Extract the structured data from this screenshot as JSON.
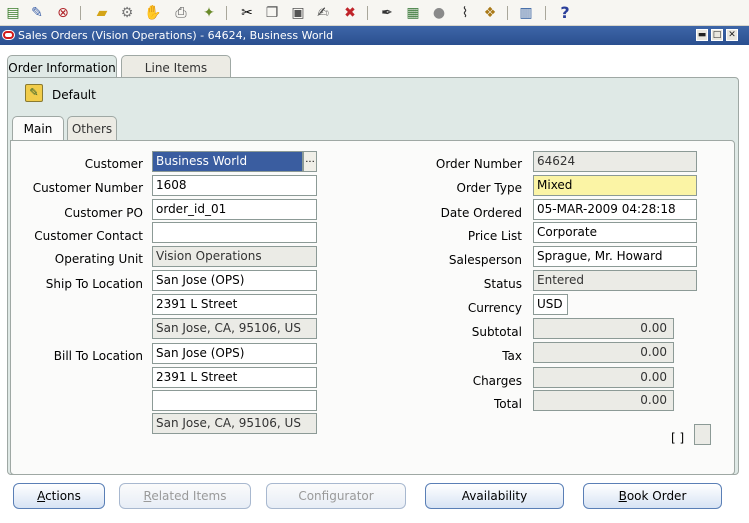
{
  "toolbar": {
    "icons": [
      "new-record-icon",
      "edit-icon",
      "clear-icon",
      "open-folder-icon",
      "navigator-icon",
      "zoom-icon",
      "print-icon",
      "stamp-icon",
      "cut-icon",
      "copy-icon",
      "paste-icon",
      "edit-field-icon",
      "delete-record-icon",
      "pen-icon",
      "form-icon",
      "attachment-ball-icon",
      "paperclip-icon",
      "translate-icon",
      "folder-tools-icon",
      "help-icon"
    ],
    "help_glyph": "?"
  },
  "window": {
    "title": "Sales Orders (Vision Operations) - 64624, Business World",
    "minimize_glyph": "▬",
    "maximize_glyph": "□",
    "close_glyph": "✕"
  },
  "tabs": {
    "order_information": "Order Information",
    "line_items": "Line Items"
  },
  "defaults": {
    "label": "Default"
  },
  "subtabs": {
    "main": "Main",
    "others": "Others"
  },
  "fields": {
    "customer": {
      "label": "Customer",
      "value": "Business World",
      "lov": "..."
    },
    "customer_number": {
      "label": "Customer Number",
      "value": "1608"
    },
    "customer_po": {
      "label": "Customer PO",
      "value": "order_id_01"
    },
    "customer_contact": {
      "label": "Customer Contact",
      "value": ""
    },
    "operating_unit": {
      "label": "Operating Unit",
      "value": "Vision Operations"
    },
    "ship_to": {
      "label": "Ship To Location",
      "line1": "San Jose (OPS)",
      "line2": "2391 L Street",
      "line3": "San Jose, CA, 95106, US"
    },
    "bill_to": {
      "label": "Bill To Location",
      "line1": "San Jose (OPS)",
      "line2": "2391 L Street",
      "line3": "",
      "line4": "San Jose, CA, 95106, US"
    },
    "order_number": {
      "label": "Order Number",
      "value": "64624"
    },
    "order_type": {
      "label": "Order Type",
      "value": "Mixed"
    },
    "date_ordered": {
      "label": "Date Ordered",
      "value": "05-MAR-2009 04:28:18"
    },
    "price_list": {
      "label": "Price List",
      "value": "Corporate"
    },
    "salesperson": {
      "label": "Salesperson",
      "value": "Sprague, Mr. Howard"
    },
    "status": {
      "label": "Status",
      "value": "Entered"
    },
    "currency": {
      "label": "Currency",
      "value": "USD"
    },
    "subtotal": {
      "label": "Subtotal",
      "value": "0.00"
    },
    "tax": {
      "label": "Tax",
      "value": "0.00"
    },
    "charges": {
      "label": "Charges",
      "value": "0.00"
    },
    "total": {
      "label": "Total",
      "value": "0.00"
    }
  },
  "flex_field": {
    "label": "[ ]"
  },
  "buttons": {
    "actions": {
      "prefix": "A",
      "rest": "ctions"
    },
    "related_items": {
      "prefix": "R",
      "rest": "elated Items"
    },
    "configurator": {
      "prefix": "",
      "rest": "Configurator"
    },
    "availability": {
      "prefix": "",
      "rest": "Availability"
    },
    "book_order": {
      "prefix": "B",
      "rest": "ook Order"
    }
  },
  "colors": {
    "title_bar": "#2f5597",
    "panel_bg": "#dfe9e6",
    "required_field": "#fbf4a5",
    "readonly_field": "#ebebe6",
    "button_border": "#5a7fb6"
  }
}
